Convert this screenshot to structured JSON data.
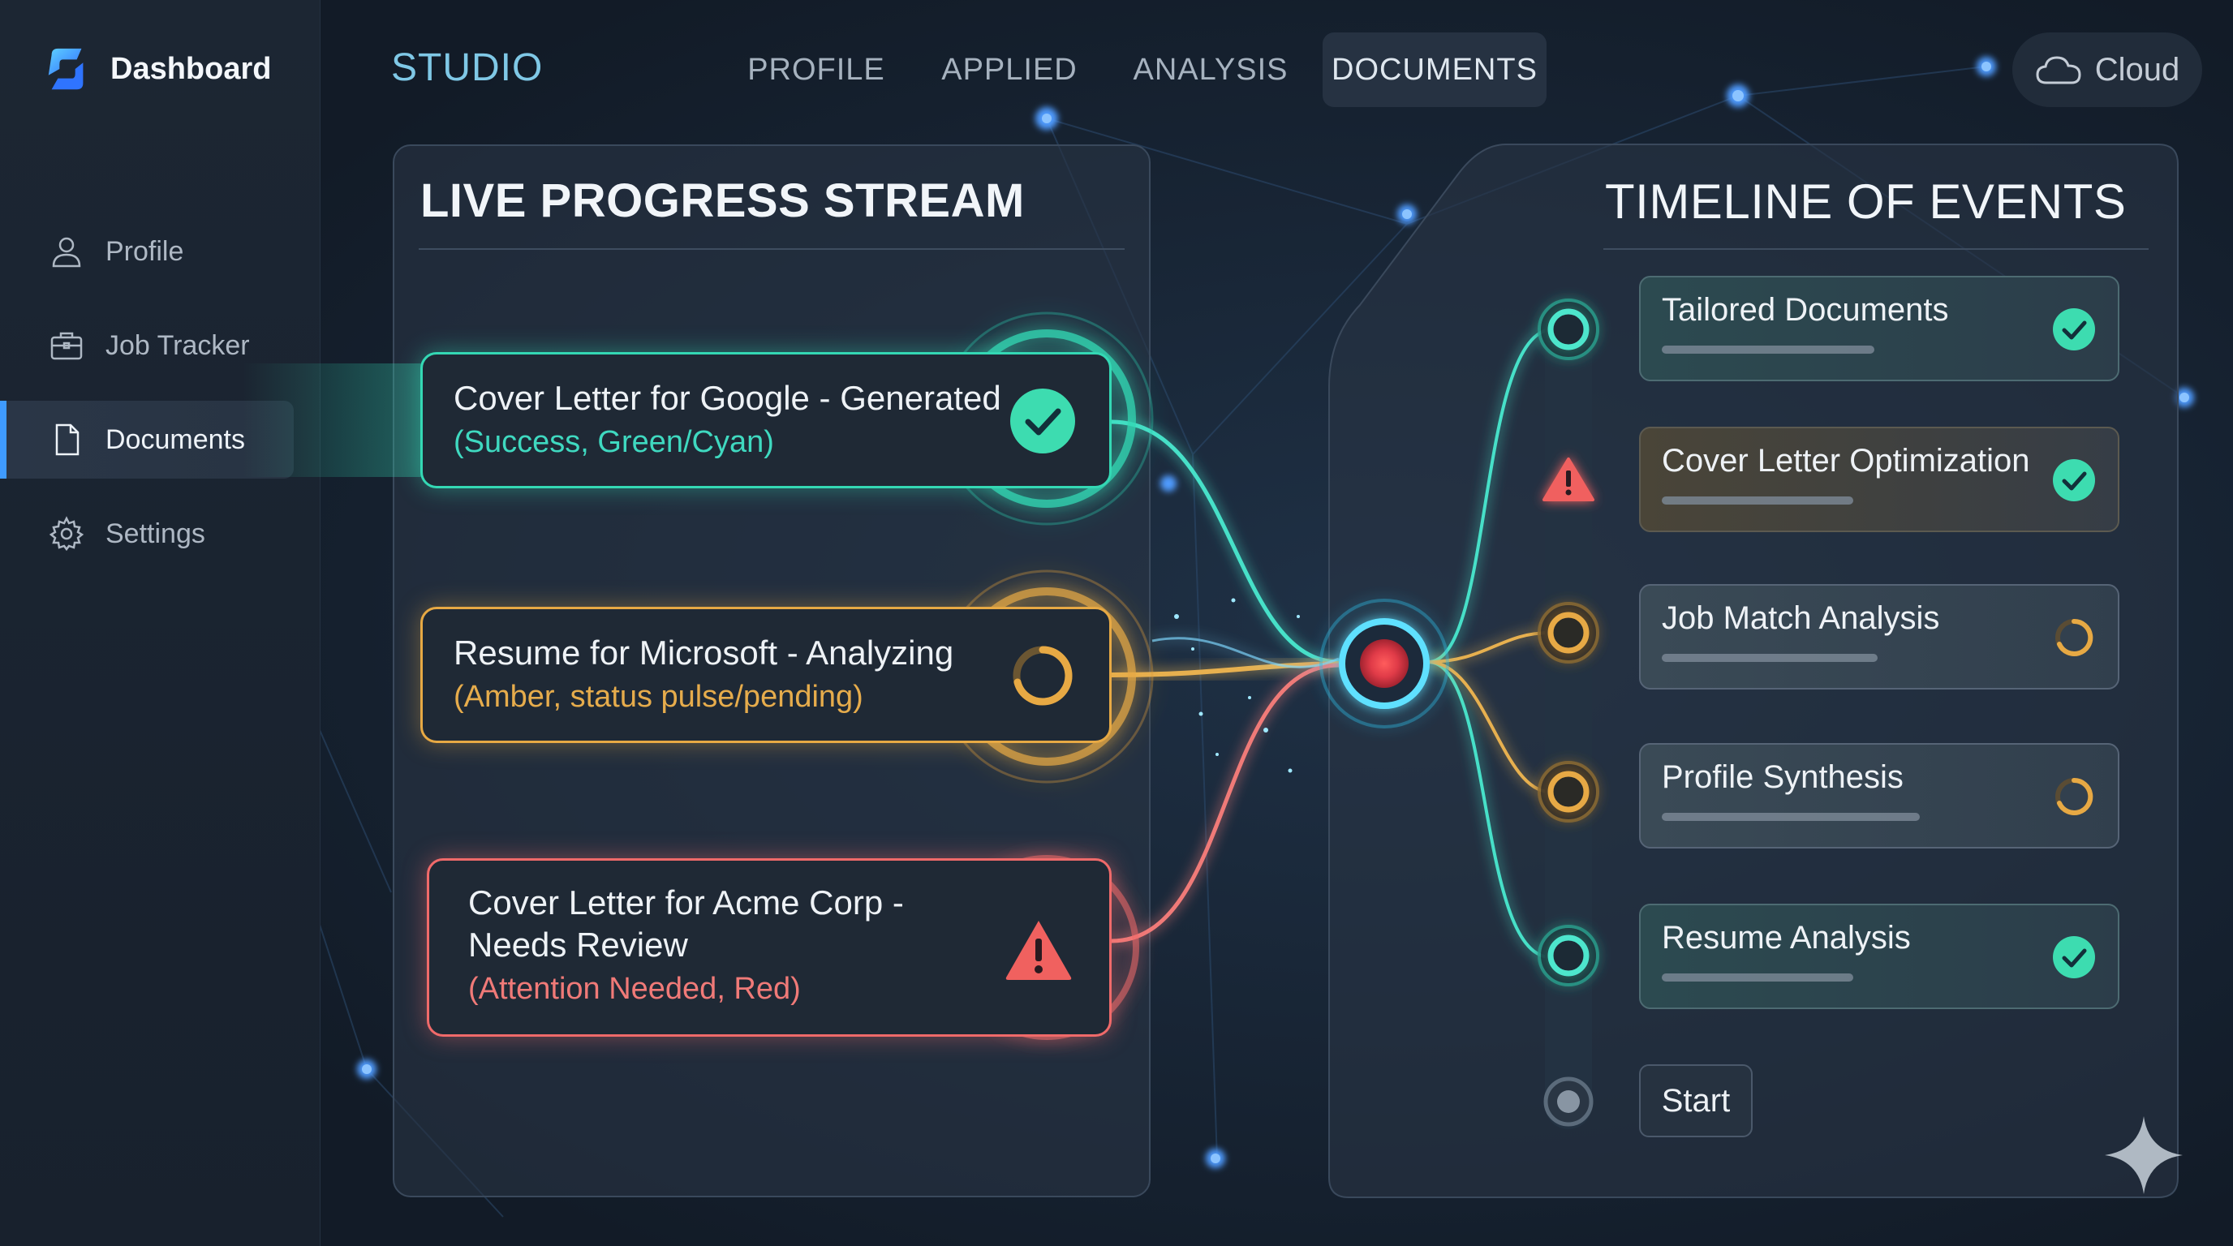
{
  "sidebar": {
    "brand": "Dashboard",
    "items": [
      {
        "label": "Profile",
        "icon": "user-icon"
      },
      {
        "label": "Job Tracker",
        "icon": "briefcase-icon"
      },
      {
        "label": "Documents",
        "icon": "document-icon",
        "active": true
      },
      {
        "label": "Settings",
        "icon": "gear-icon"
      }
    ]
  },
  "header": {
    "studio": "STUDIO",
    "tabs": [
      {
        "label": "PROFILE"
      },
      {
        "label": "APPLIED"
      },
      {
        "label": "ANALYSIS"
      },
      {
        "label": "DOCUMENTS",
        "active": true
      }
    ],
    "cloud_label": "Cloud"
  },
  "stream": {
    "title": "LIVE PROGRESS STREAM",
    "items": [
      {
        "title": "Cover Letter for Google - Generated",
        "subtitle": "(Success, Green/Cyan)",
        "status": "success",
        "color": "#34d8b4"
      },
      {
        "title": "Resume for Microsoft - Analyzing",
        "subtitle": "(Amber, status pulse/pending)",
        "status": "pending",
        "color": "#e7a944"
      },
      {
        "title_line1": "Cover Letter for Acme Corp -",
        "title_line2": "Needs Review",
        "subtitle": "(Attention Needed, Red)",
        "status": "warning",
        "color": "#f06a6a"
      }
    ]
  },
  "timeline": {
    "title": "TIMELINE OF EVENTS",
    "events": [
      {
        "label": "Tailored Documents",
        "status": "done"
      },
      {
        "label": "Cover Letter Optimization",
        "status": "done"
      },
      {
        "label": "Job Match Analysis",
        "status": "pending"
      },
      {
        "label": "Profile Synthesis",
        "status": "pending"
      },
      {
        "label": "Resume Analysis",
        "status": "done"
      }
    ],
    "start_label": "Start"
  },
  "colors": {
    "success": "#34d8b4",
    "pending": "#e7a944",
    "warning": "#f06a6a",
    "accent": "#3f9bff"
  }
}
